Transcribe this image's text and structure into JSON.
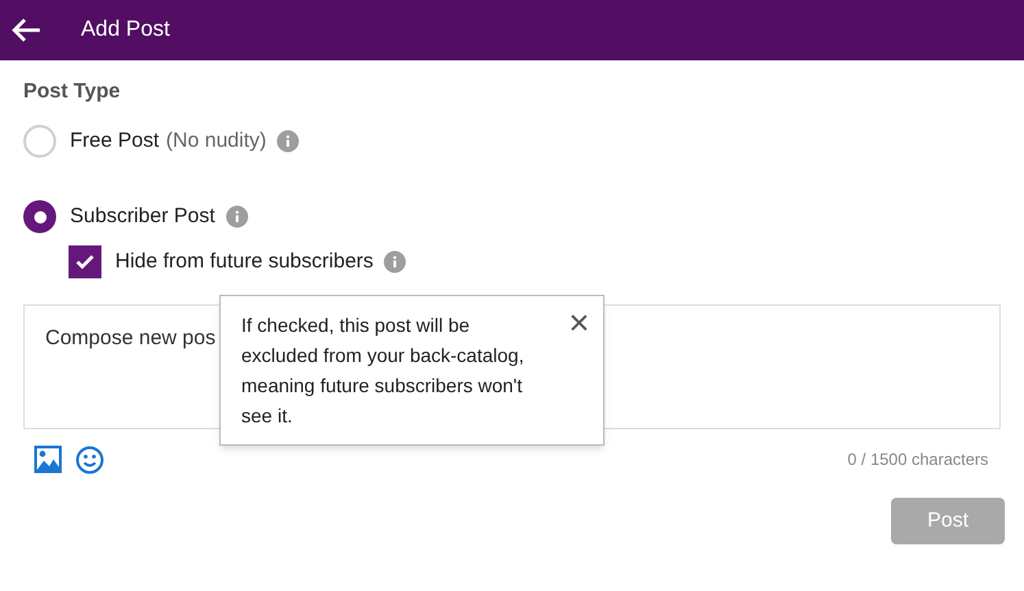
{
  "header": {
    "title": "Add Post"
  },
  "post_type": {
    "label": "Post Type",
    "options": [
      {
        "label": "Free Post",
        "note": "(No nudity)",
        "selected": false
      },
      {
        "label": "Subscriber Post",
        "selected": true
      }
    ],
    "hide_option": {
      "label": "Hide from future subscribers",
      "checked": true
    }
  },
  "tooltip": {
    "text": "If checked, this post will be excluded from your back-catalog, meaning future subscribers won't see it.",
    "close": "×"
  },
  "composer": {
    "placeholder": "Compose new pos",
    "counter": "0 / 1500 characters"
  },
  "post_button": {
    "label": "Post",
    "disabled": true
  }
}
